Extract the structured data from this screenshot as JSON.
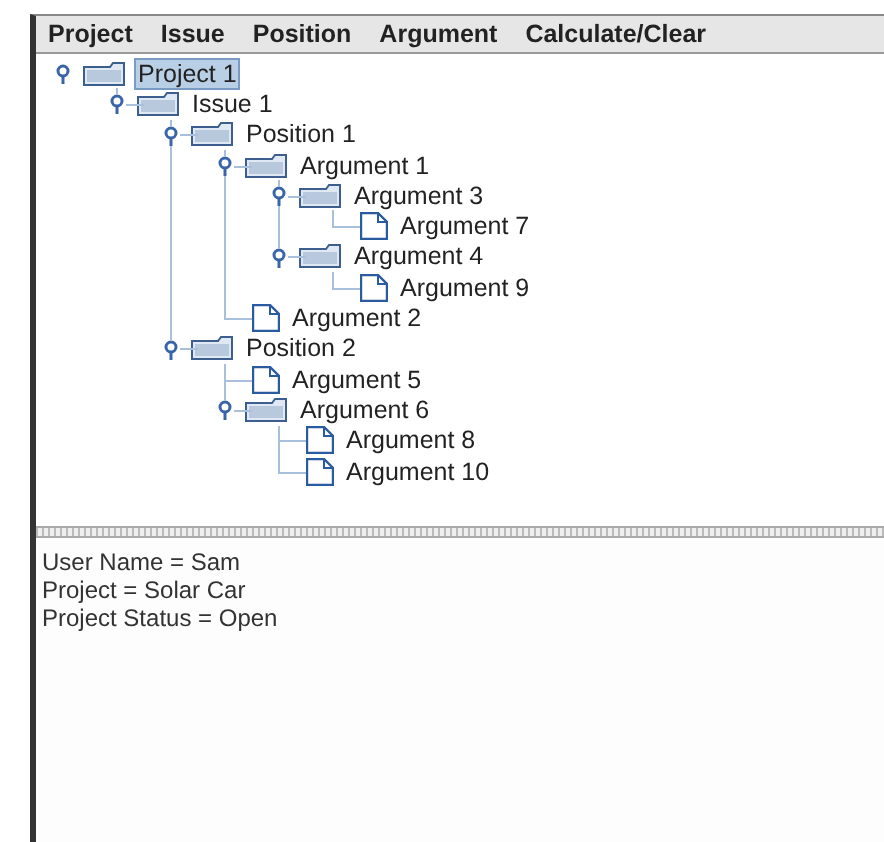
{
  "menu": [
    "Project",
    "Issue",
    "Position",
    "Argument",
    "Calculate/Clear"
  ],
  "tree": [
    {
      "label": "Project 1",
      "kind": "folder",
      "expanded": true,
      "selected": true,
      "children": [
        {
          "label": "Issue 1",
          "kind": "folder",
          "expanded": true,
          "selected": false,
          "children": [
            {
              "label": "Position 1",
              "kind": "folder",
              "expanded": true,
              "selected": false,
              "children": [
                {
                  "label": "Argument 1",
                  "kind": "folder",
                  "expanded": true,
                  "selected": false,
                  "children": [
                    {
                      "label": "Argument 3",
                      "kind": "folder",
                      "expanded": true,
                      "selected": false,
                      "children": [
                        {
                          "label": "Argument 7",
                          "kind": "leaf",
                          "selected": false
                        }
                      ]
                    },
                    {
                      "label": "Argument 4",
                      "kind": "folder",
                      "expanded": true,
                      "selected": false,
                      "children": [
                        {
                          "label": "Argument 9",
                          "kind": "leaf",
                          "selected": false
                        }
                      ]
                    }
                  ]
                },
                {
                  "label": "Argument 2",
                  "kind": "leaf",
                  "selected": false
                }
              ]
            },
            {
              "label": "Position 2",
              "kind": "folder",
              "expanded": true,
              "selected": false,
              "children": [
                {
                  "label": "Argument 5",
                  "kind": "leaf",
                  "selected": false
                },
                {
                  "label": "Argument 6",
                  "kind": "folder",
                  "expanded": true,
                  "selected": false,
                  "children": [
                    {
                      "label": "Argument 8",
                      "kind": "leaf",
                      "selected": false
                    },
                    {
                      "label": "Argument 10",
                      "kind": "leaf",
                      "selected": false
                    }
                  ]
                }
              ]
            }
          ]
        }
      ]
    }
  ],
  "info_lines": [
    "User Name = Sam",
    "Project = Solar Car",
    "Project Status = Open"
  ]
}
